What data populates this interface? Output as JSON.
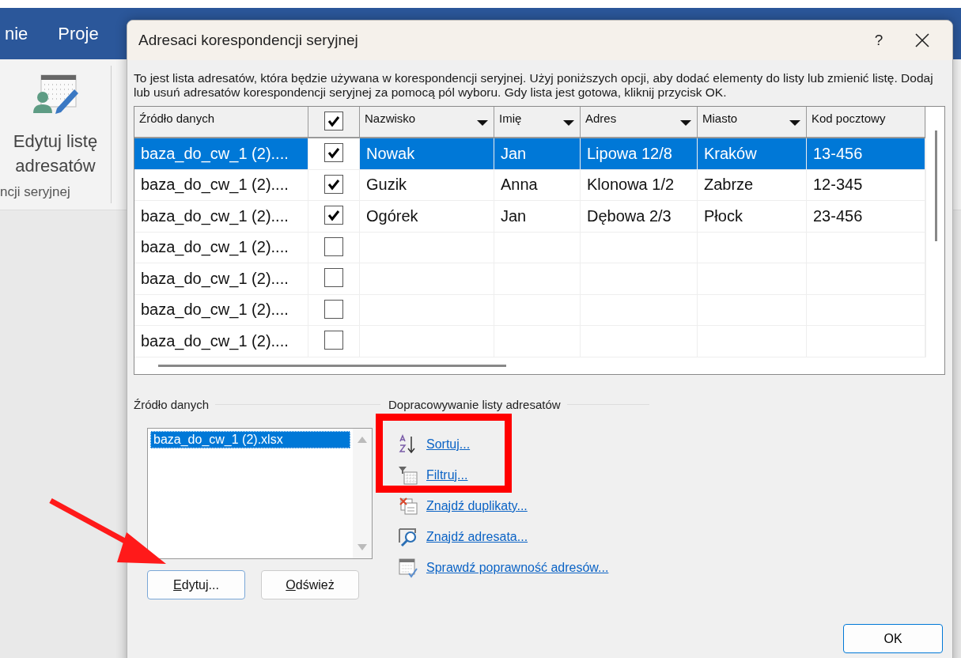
{
  "background_app": {
    "tabs": [
      {
        "label": "nie"
      },
      {
        "label": "Proje"
      }
    ],
    "ribbon_button": {
      "label": "Edytuj listę adresatów"
    },
    "group_label": "ncji seryjnej"
  },
  "dialog": {
    "title": "Adresaci korespondencji seryjnej",
    "help": "?",
    "description": "To jest lista adresatów, która będzie używana w korespondencji seryjnej. Użyj poniższych opcji, aby dodać elementy do listy lub zmienić listę. Dodaj lub usuń adresatów korespondencji seryjnej za pomocą pól wyboru. Gdy lista jest gotowa, kliknij przycisk OK.",
    "table": {
      "columns": [
        {
          "kind": "text",
          "label": "Źródło danych",
          "dropdown": false
        },
        {
          "kind": "checkbox",
          "checked": true
        },
        {
          "kind": "text",
          "label": "Nazwisko",
          "dropdown": true
        },
        {
          "kind": "text",
          "label": "Imię",
          "dropdown": true
        },
        {
          "kind": "text",
          "label": "Adres",
          "dropdown": true
        },
        {
          "kind": "text",
          "label": "Miasto",
          "dropdown": true
        },
        {
          "kind": "text",
          "label": "Kod pocztowy",
          "dropdown": false
        }
      ],
      "rows": [
        {
          "source": "baza_do_cw_1 (2)....",
          "checked": true,
          "selected": true,
          "cells": [
            "Nowak",
            "Jan",
            "Lipowa 12/8",
            "Kraków",
            "13-456"
          ]
        },
        {
          "source": "baza_do_cw_1 (2)....",
          "checked": true,
          "selected": false,
          "cells": [
            "Guzik",
            "Anna",
            "Klonowa 1/2",
            "Zabrze",
            "12-345"
          ]
        },
        {
          "source": "baza_do_cw_1 (2)....",
          "checked": true,
          "selected": false,
          "cells": [
            "Ogórek",
            "Jan",
            "Dębowa 2/3",
            "Płock",
            "23-456"
          ]
        },
        {
          "source": "baza_do_cw_1 (2)....",
          "checked": false,
          "selected": false
        },
        {
          "source": "baza_do_cw_1 (2)....",
          "checked": false,
          "selected": false
        },
        {
          "source": "baza_do_cw_1 (2)....",
          "checked": false,
          "selected": false
        },
        {
          "source": "baza_do_cw_1 (2)....",
          "checked": false,
          "selected": false
        }
      ]
    },
    "source_panel": {
      "label": "Źródło danych",
      "items": [
        {
          "label": "baza_do_cw_1 (2).xlsx",
          "selected": true
        }
      ],
      "buttons": [
        {
          "label": "Edytuj...",
          "focused": true
        },
        {
          "label": "Odśwież",
          "focused": false
        }
      ]
    },
    "refine_panel": {
      "label": "Dopracowywanie listy adresatów",
      "links": [
        {
          "label": "Sortuj...",
          "kind": "sort"
        },
        {
          "label": "Filtruj...",
          "kind": "filter"
        },
        {
          "label": "Znajdź duplikaty...",
          "kind": "duplicates"
        },
        {
          "label": "Znajdź adresata...",
          "kind": "find"
        },
        {
          "label": "Sprawdź poprawność adresów...",
          "kind": "validate"
        }
      ]
    },
    "ok": "OK"
  },
  "annotations": {
    "highlight_box": true,
    "arrow": true
  }
}
